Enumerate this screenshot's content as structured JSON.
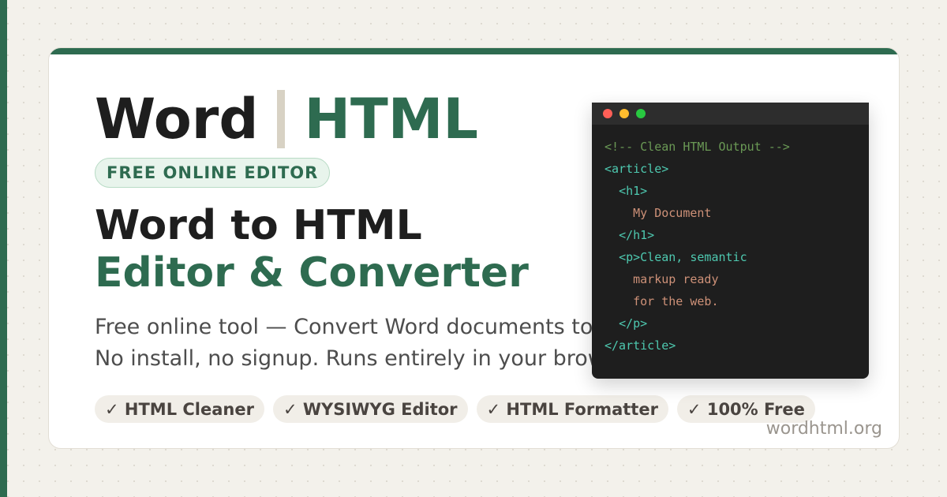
{
  "brand": {
    "word": "Word",
    "html": "HTML"
  },
  "badge": "FREE ONLINE EDITOR",
  "headline": {
    "line1": "Word to HTML",
    "line2": "Editor & Converter"
  },
  "description": {
    "line1": "Free online tool — Convert Word documents to",
    "line2": "No install, no signup. Runs entirely in your browser"
  },
  "features": [
    "✓ HTML Cleaner",
    "✓ WYSIWYG Editor",
    "✓ HTML Formatter",
    "✓ 100% Free"
  ],
  "site_url": "wordhtml.org",
  "code_window": {
    "lines": [
      {
        "indent": "",
        "kind": "comment",
        "text": "<!-- Clean HTML Output -->"
      },
      {
        "indent": "",
        "kind": "tag",
        "text": "<article>"
      },
      {
        "indent": "  ",
        "kind": "tag",
        "text": "<h1>"
      },
      {
        "indent": "    ",
        "kind": "text",
        "text": "My Document"
      },
      {
        "indent": "  ",
        "kind": "tag",
        "text": "</h1>"
      },
      {
        "indent": "  ",
        "kind": "tag",
        "text": "<p>",
        "rest": "Clean, semantic"
      },
      {
        "indent": "    ",
        "kind": "text",
        "text": "markup ready"
      },
      {
        "indent": "    ",
        "kind": "text",
        "text": "for the web."
      },
      {
        "indent": "  ",
        "kind": "tag",
        "text": "</p>"
      },
      {
        "indent": "",
        "kind": "tag",
        "text": "</article>"
      }
    ]
  },
  "colors": {
    "accent": "#2e6b50",
    "comment": "#6a9955",
    "tag": "#4ec9b0",
    "text": "#ce9178",
    "window_close": "#ff5f57",
    "window_minimize": "#febc2e",
    "window_maximize": "#28c840"
  },
  "icons": {
    "window_controls": [
      "close-dot-icon",
      "minimize-dot-icon",
      "maximize-dot-icon"
    ]
  }
}
